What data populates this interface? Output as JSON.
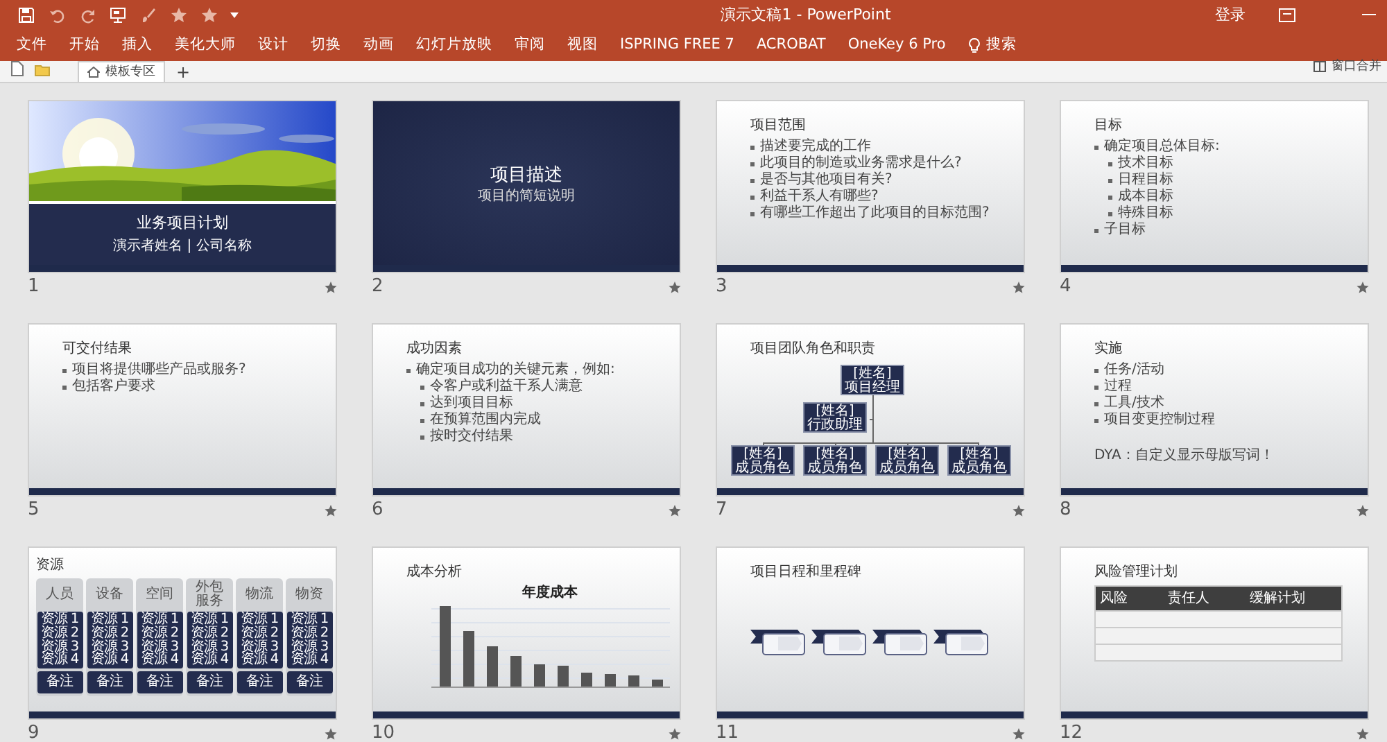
{
  "window": {
    "title": "演示文稿1 - PowerPoint",
    "account": "登录"
  },
  "ribbon_tabs": [
    {
      "label": "文件"
    },
    {
      "label": "开始"
    },
    {
      "label": "插入"
    },
    {
      "label": "美化大师"
    },
    {
      "label": "设计"
    },
    {
      "label": "切换"
    },
    {
      "label": "动画"
    },
    {
      "label": "幻灯片放映"
    },
    {
      "label": "审阅"
    },
    {
      "label": "视图"
    },
    {
      "label": "ISPRING FREE 7"
    },
    {
      "label": "ACROBAT"
    },
    {
      "label": "OneKey 6 Pro"
    }
  ],
  "search": {
    "label": "搜索"
  },
  "doc_tabs": {
    "tabs": [
      {
        "label": "模板专区",
        "selected": true
      }
    ],
    "new_tab": "+",
    "merge_button": "窗口合并"
  },
  "slides": [
    {
      "number": "1",
      "kind": "photo-title",
      "title": "业务项目计划",
      "subtitle": "演示者姓名 | 公司名称"
    },
    {
      "number": "2",
      "kind": "section",
      "title": "项目描述",
      "subtitle": "项目的简短说明"
    },
    {
      "number": "3",
      "kind": "bullets",
      "title": "项目范围",
      "bullets": [
        {
          "text": "描述要完成的工作"
        },
        {
          "text": "此项目的制造或业务需求是什么?"
        },
        {
          "text": "是否与其他项目有关?"
        },
        {
          "text": "利益干系人有哪些?"
        },
        {
          "text": "有哪些工作超出了此项目的目标范围?"
        }
      ]
    },
    {
      "number": "4",
      "kind": "bullets",
      "title": "目标",
      "bullets": [
        {
          "text": "确定项目总体目标:",
          "children": [
            {
              "text": "技术目标"
            },
            {
              "text": "日程目标"
            },
            {
              "text": "成本目标"
            },
            {
              "text": "特殊目标"
            }
          ]
        },
        {
          "text": "子目标"
        }
      ]
    },
    {
      "number": "5",
      "kind": "bullets",
      "title": "可交付结果",
      "bullets": [
        {
          "text": "项目将提供哪些产品或服务?"
        },
        {
          "text": "包括客户要求"
        }
      ]
    },
    {
      "number": "6",
      "kind": "bullets",
      "title": "成功因素",
      "bullets": [
        {
          "text": "确定项目成功的关键元素，例如:",
          "children": [
            {
              "text": "令客户或利益干系人满意"
            },
            {
              "text": "达到项目目标"
            },
            {
              "text": "在预算范围内完成"
            },
            {
              "text": "按时交付结果"
            }
          ]
        }
      ]
    },
    {
      "number": "7",
      "kind": "org-chart",
      "title": "项目团队角色和职责",
      "manager": {
        "name": "[姓名]",
        "role": "项目经理"
      },
      "assistant": {
        "name": "[姓名]",
        "role": "行政助理"
      },
      "members": [
        {
          "name": "[姓名]",
          "role": "成员角色"
        },
        {
          "name": "[姓名]",
          "role": "成员角色"
        },
        {
          "name": "[姓名]",
          "role": "成员角色"
        },
        {
          "name": "[姓名]",
          "role": "成员角色"
        }
      ]
    },
    {
      "number": "8",
      "kind": "bullets",
      "title": "实施",
      "bullets": [
        {
          "text": "任务/活动"
        },
        {
          "text": "过程"
        },
        {
          "text": "工具/技术"
        },
        {
          "text": "项目变更控制过程"
        }
      ],
      "note": "DYA：自定义显示母版写词！"
    },
    {
      "number": "9",
      "kind": "resources",
      "title": "资源",
      "columns": [
        {
          "header": "人员",
          "items": [
            "资源 1",
            "资源 2",
            "资源 3",
            "资源 4"
          ],
          "note": "备注"
        },
        {
          "header": "设备",
          "items": [
            "资源 1",
            "资源 2",
            "资源 3",
            "资源 4"
          ],
          "note": "备注"
        },
        {
          "header": "空间",
          "items": [
            "资源 1",
            "资源 2",
            "资源 3",
            "资源 4"
          ],
          "note": "备注"
        },
        {
          "header": "外包服务",
          "items": [
            "资源 1",
            "资源 2",
            "资源 3",
            "资源 4"
          ],
          "note": "备注"
        },
        {
          "header": "物流",
          "items": [
            "资源 1",
            "资源 2",
            "资源 3",
            "资源 4"
          ],
          "note": "备注"
        },
        {
          "header": "物资",
          "items": [
            "资源 1",
            "资源 2",
            "资源 3",
            "资源 4"
          ],
          "note": "备注"
        }
      ]
    },
    {
      "number": "10",
      "kind": "chart",
      "title": "成本分析",
      "chart_title": "年度成本"
    },
    {
      "number": "11",
      "kind": "timeline",
      "title": "项目日程和里程碑"
    },
    {
      "number": "12",
      "kind": "table",
      "title": "风险管理计划",
      "columns": [
        "风险",
        "责任人",
        "缓解计划"
      ]
    }
  ]
}
